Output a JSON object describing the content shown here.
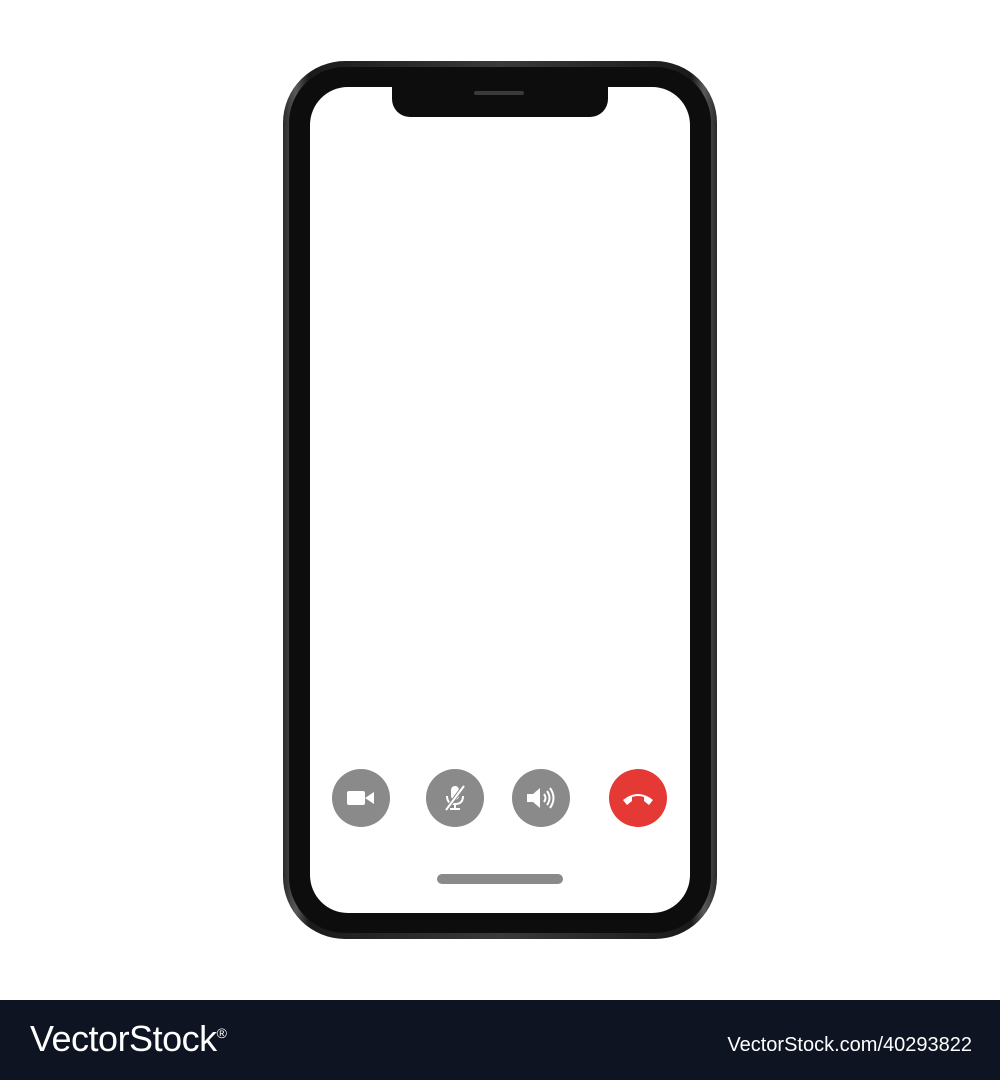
{
  "phone": {
    "call_controls": [
      {
        "icon": "video-camera-icon",
        "color": "#8a8a8a"
      },
      {
        "icon": "microphone-muted-icon",
        "color": "#8a8a8a"
      },
      {
        "icon": "speaker-icon",
        "color": "#8a8a8a"
      },
      {
        "icon": "end-call-icon",
        "color": "#e53935"
      }
    ],
    "screen_color": "#ffffff",
    "frame_color": "#1a1a1a"
  },
  "watermark": {
    "brand": "VectorStock",
    "registered_mark": "®",
    "image_id": "VectorStock.com/40293822"
  }
}
